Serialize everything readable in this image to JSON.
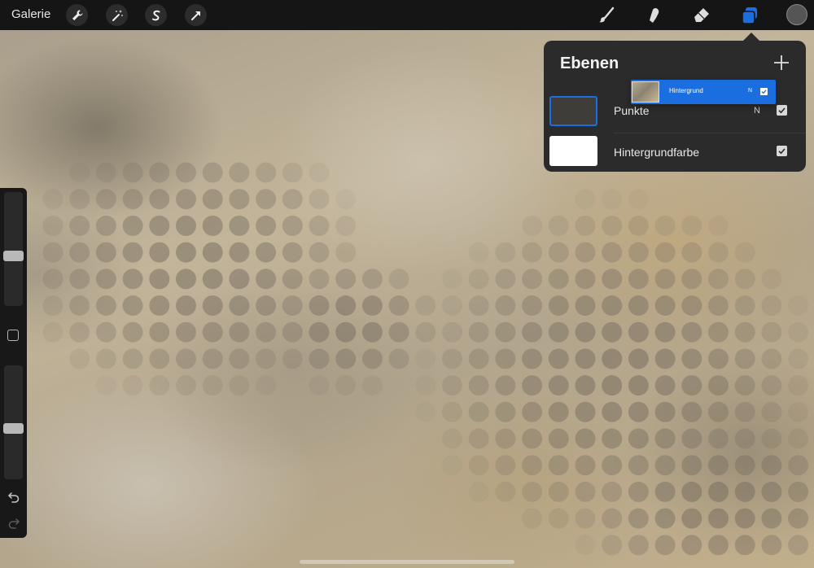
{
  "topbar": {
    "gallery_label": "Galerie",
    "left_tools": [
      "wrench-icon",
      "magic-wand-icon",
      "selection-icon",
      "transform-arrow-icon"
    ],
    "right_tools": [
      "brush-icon",
      "smudge-icon",
      "eraser-icon",
      "layers-icon"
    ],
    "active_color": "#555555",
    "layers_accent": "#1a6ee0"
  },
  "sidebar": {
    "brush_size_level": 0.55,
    "opacity_level": 0.55,
    "icons": [
      "modify-square-icon",
      "undo-icon",
      "redo-icon"
    ]
  },
  "layers_panel": {
    "title": "Ebenen",
    "add_icon": "plus-icon",
    "layers": [
      {
        "name": "Punkte",
        "blend_mode": "N",
        "visible": true,
        "selected": true,
        "thumb_color": "#3f3d3a"
      },
      {
        "name": "Hintergrundfarbe",
        "blend_mode": "",
        "visible": true,
        "selected": false,
        "thumb_color": "#ffffff"
      }
    ],
    "dragged_layer": {
      "name": "Hintergrund",
      "blend_mode": "N",
      "visible": true
    }
  }
}
